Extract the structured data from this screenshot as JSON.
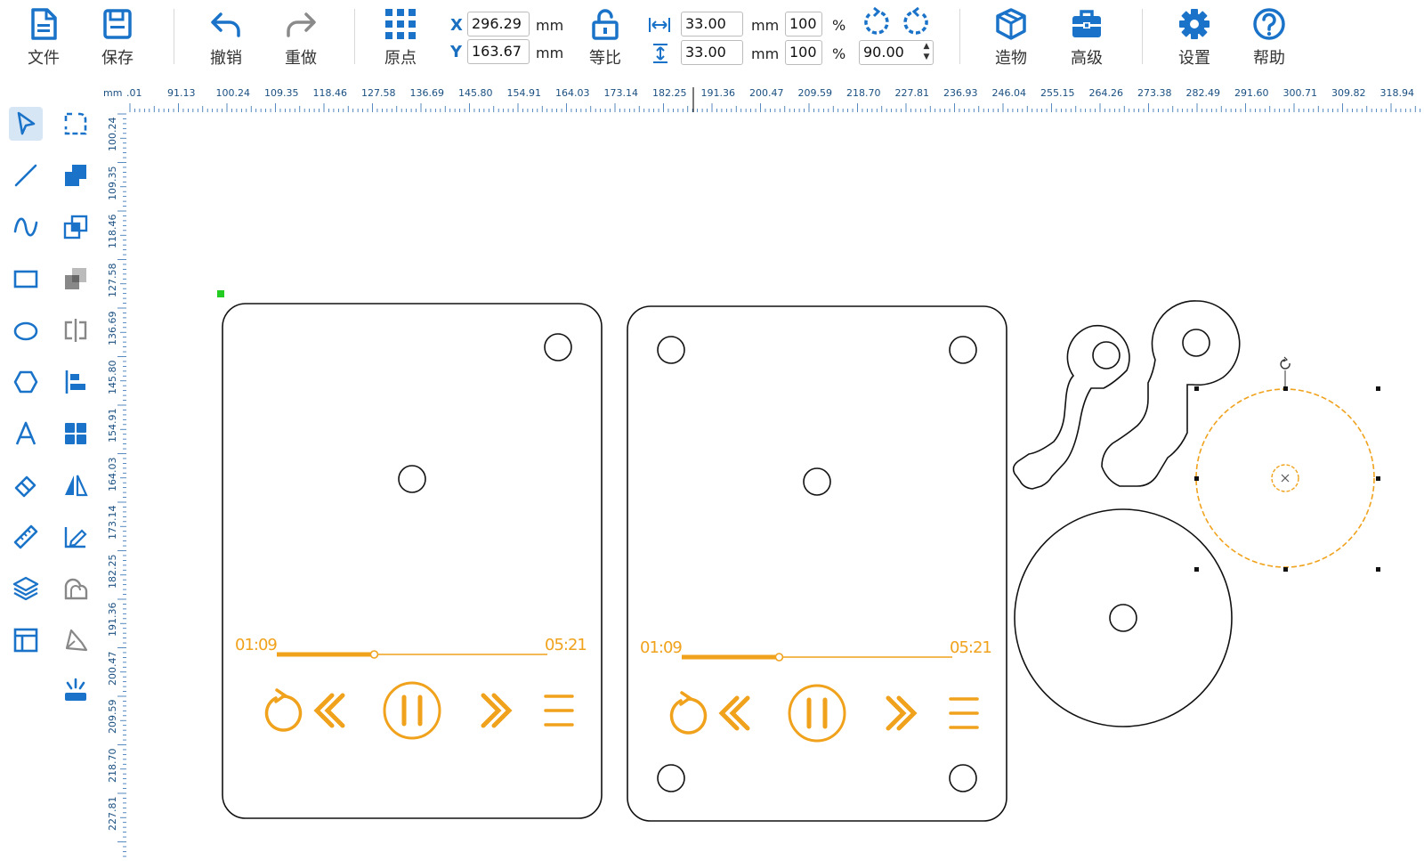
{
  "toolbar": {
    "file_label": "文件",
    "save_label": "保存",
    "undo_label": "撤销",
    "redo_label": "重做",
    "origin_label": "原点",
    "x_label": "X",
    "x_value": "296.29",
    "y_label": "Y",
    "y_value": "163.67",
    "pos_unit": "mm",
    "ratio_label": "等比",
    "width_value": "33.00",
    "height_value": "33.00",
    "size_unit": "mm",
    "width_percent": "100",
    "height_percent": "100",
    "percent_sign": "%",
    "rotation_value": "90.00",
    "build_label": "造物",
    "advanced_label": "高级",
    "settings_label": "设置",
    "help_label": "帮助"
  },
  "palette": {
    "tools": [
      "select-tool",
      "node-edit-tool",
      "line-tool",
      "union-tool",
      "curve-tool",
      "group-tool",
      "rectangle-tool",
      "subtract-tool",
      "ellipse-tool",
      "split-tool",
      "polygon-tool",
      "align-tool",
      "text-tool",
      "array-tool",
      "eraser-tool",
      "mirror-tool",
      "measure-tool",
      "trace-tool",
      "layers-tool",
      "weld-tool",
      "template-tool",
      "pen-tool",
      "laser-tool"
    ]
  },
  "ruler": {
    "unit": "mm",
    "h_labels": [
      ".01",
      "91.13",
      "100.24",
      "109.35",
      "118.46",
      "127.58",
      "136.69",
      "145.80",
      "154.91",
      "164.03",
      "173.14",
      "182.25",
      "191.36",
      "200.47",
      "209.59",
      "218.70",
      "227.81",
      "236.93",
      "246.04",
      "255.15",
      "264.26",
      "273.38",
      "282.49",
      "291.60",
      "300.71",
      "309.82",
      "318.94"
    ],
    "v_labels": [
      "100.24",
      "109.35",
      "118.46",
      "127.58",
      "136.69",
      "145.80",
      "154.91",
      "164.03",
      "173.14",
      "182.25",
      "191.36",
      "200.47",
      "209.59",
      "218.70",
      "227.81"
    ]
  },
  "canvas": {
    "panel1": {
      "time_start": "01:09",
      "time_end": "05:21",
      "progress": 0.36
    },
    "panel2": {
      "time_start": "01:09",
      "time_end": "05:21",
      "progress": 0.36
    },
    "accent_color": "#f0a21c",
    "brand_color": "#1a73c8"
  }
}
